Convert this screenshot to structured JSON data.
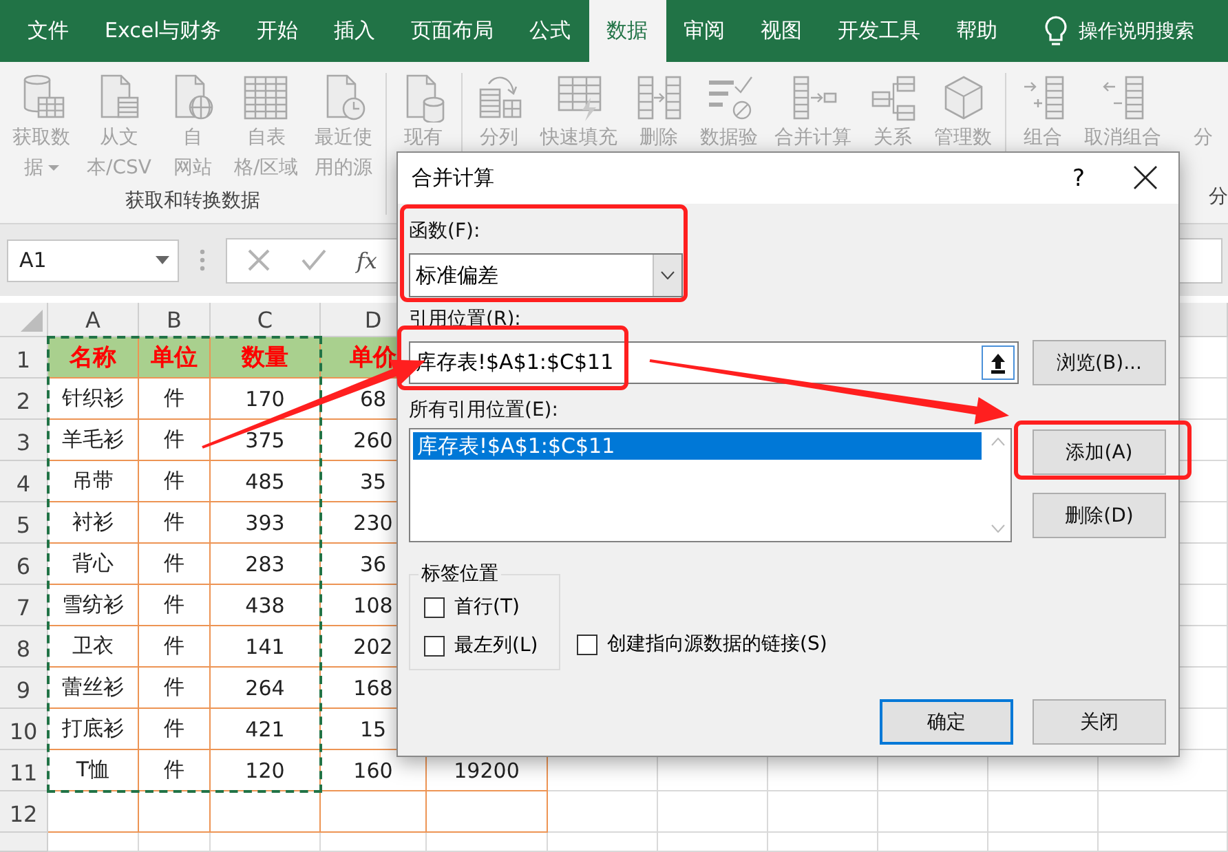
{
  "menu_bar": {
    "tabs": [
      {
        "label": "文件",
        "selected": false
      },
      {
        "label": "Excel与财务",
        "selected": false
      },
      {
        "label": "开始",
        "selected": false
      },
      {
        "label": "插入",
        "selected": false
      },
      {
        "label": "页面布局",
        "selected": false
      },
      {
        "label": "公式",
        "selected": false
      },
      {
        "label": "数据",
        "selected": true
      },
      {
        "label": "审阅",
        "selected": false
      },
      {
        "label": "视图",
        "selected": false
      },
      {
        "label": "开发工具",
        "selected": false
      },
      {
        "label": "帮助",
        "selected": false
      }
    ],
    "search": {
      "label": "操作说明搜索"
    }
  },
  "ribbon": {
    "groups": [
      {
        "label": "获取和转换数据",
        "buttons": [
          {
            "lines": [
              "获取数",
              "据"
            ],
            "dropdown": true,
            "disabled": true
          },
          {
            "lines": [
              "从文",
              "本/CSV"
            ],
            "dropdown": false,
            "disabled": true
          },
          {
            "lines": [
              "自",
              "网站"
            ],
            "dropdown": false,
            "disabled": true
          },
          {
            "lines": [
              "自表",
              "格/区域"
            ],
            "dropdown": false,
            "disabled": true
          },
          {
            "lines": [
              "最近使",
              "用的源"
            ],
            "dropdown": false,
            "disabled": true
          }
        ]
      },
      {
        "buttons": [
          {
            "lines": [
              "现有"
            ],
            "dropdown": false,
            "disabled": true
          }
        ]
      },
      {
        "buttons": [
          {
            "lines": [
              "分列"
            ],
            "dropdown": false,
            "disabled": true
          },
          {
            "lines": [
              "快速填充"
            ],
            "dropdown": false,
            "disabled": true
          },
          {
            "lines": [
              "删除"
            ],
            "dropdown": false,
            "disabled": true
          },
          {
            "lines": [
              "数据验"
            ],
            "dropdown": false,
            "disabled": true
          },
          {
            "lines": [
              "合并计算"
            ],
            "dropdown": false,
            "disabled": true
          },
          {
            "lines": [
              "关系"
            ],
            "dropdown": false,
            "disabled": true
          },
          {
            "lines": [
              "管理数"
            ],
            "dropdown": false,
            "disabled": true
          }
        ]
      },
      {
        "label": "分",
        "buttons": [
          {
            "lines": [
              "组合"
            ],
            "dropdown": false,
            "disabled": true
          },
          {
            "lines": [
              "取消组合"
            ],
            "dropdown": false,
            "disabled": true
          },
          {
            "lines": [
              "分"
            ],
            "dropdown": false,
            "disabled": true
          }
        ]
      }
    ]
  },
  "formula_bar": {
    "name_box": "A1",
    "function_label": "fx"
  },
  "sheet": {
    "columns": [
      "A",
      "B",
      "C",
      "D"
    ],
    "marquee": true,
    "rows": [
      {
        "header": "1",
        "kind": "title",
        "cells": [
          "名称",
          "单位",
          "数量",
          "单价"
        ]
      },
      {
        "header": "2",
        "kind": "data",
        "cells": [
          "针织衫",
          "件",
          "170",
          "68"
        ]
      },
      {
        "header": "3",
        "kind": "data",
        "cells": [
          "羊毛衫",
          "件",
          "375",
          "260"
        ]
      },
      {
        "header": "4",
        "kind": "data",
        "cells": [
          "吊带",
          "件",
          "485",
          "35"
        ]
      },
      {
        "header": "5",
        "kind": "data",
        "cells": [
          "衬衫",
          "件",
          "393",
          "230"
        ]
      },
      {
        "header": "6",
        "kind": "data",
        "cells": [
          "背心",
          "件",
          "283",
          "36"
        ]
      },
      {
        "header": "7",
        "kind": "data",
        "cells": [
          "雪纺衫",
          "件",
          "438",
          "108"
        ]
      },
      {
        "header": "8",
        "kind": "data",
        "cells": [
          "卫衣",
          "件",
          "141",
          "202"
        ]
      },
      {
        "header": "9",
        "kind": "data",
        "cells": [
          "蕾丝衫",
          "件",
          "264",
          "168"
        ]
      },
      {
        "header": "10",
        "kind": "data",
        "cells": [
          "打底衫",
          "件",
          "421",
          "15"
        ]
      },
      {
        "header": "11",
        "kind": "data",
        "cells": [
          "T恤",
          "件",
          "120",
          "160",
          "19200"
        ]
      },
      {
        "header": "12",
        "kind": "data",
        "cells": []
      }
    ]
  },
  "dialog": {
    "title": "合并计算",
    "help": "?",
    "function": {
      "label": "函数(F):",
      "value": "标准偏差"
    },
    "reference": {
      "label": "引用位置(R):",
      "value": "库存表!$A$1:$C$11"
    },
    "browse_button": "浏览(B)...",
    "all_references": {
      "label": "所有引用位置(E):",
      "items": [
        {
          "text": "库存表!$A$1:$C$11",
          "selected": true
        }
      ]
    },
    "add_button": "添加(A)",
    "delete_button": "删除(D)",
    "labels_group": {
      "title": "标签位置",
      "options": [
        {
          "label": "首行(T)",
          "checked": false
        },
        {
          "label": "最左列(L)",
          "checked": false
        }
      ]
    },
    "link_option": {
      "label": "创建指向源数据的链接(S)",
      "checked": false
    },
    "ok_button": "确定",
    "close_button": "关闭"
  }
}
